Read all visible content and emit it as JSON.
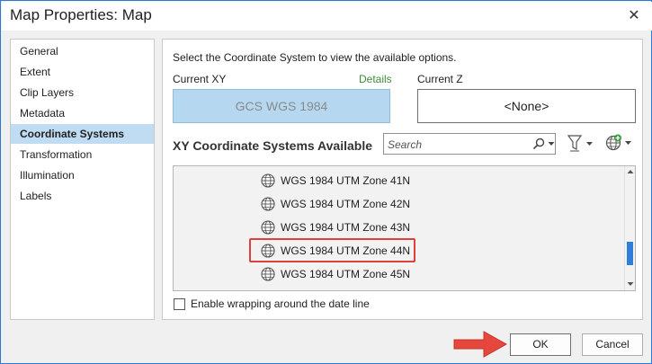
{
  "window": {
    "title": "Map Properties: Map",
    "close_symbol": "✕"
  },
  "sidebar": {
    "items": [
      {
        "label": "General",
        "active": false
      },
      {
        "label": "Extent",
        "active": false
      },
      {
        "label": "Clip Layers",
        "active": false
      },
      {
        "label": "Metadata",
        "active": false
      },
      {
        "label": "Coordinate Systems",
        "active": true
      },
      {
        "label": "Transformation",
        "active": false
      },
      {
        "label": "Illumination",
        "active": false
      },
      {
        "label": "Labels",
        "active": false
      }
    ]
  },
  "main": {
    "instruction": "Select the Coordinate System to view the available options.",
    "current_xy": {
      "label": "Current XY",
      "details_link": "Details",
      "value": "GCS WGS 1984"
    },
    "current_z": {
      "label": "Current Z",
      "value": "<None>"
    },
    "available": {
      "label": "XY Coordinate Systems Available",
      "search_placeholder": "Search",
      "items": [
        {
          "label": "WGS 1984 UTM Zone 41N",
          "icon": "globe-icon",
          "highlighted": false
        },
        {
          "label": "WGS 1984 UTM Zone 42N",
          "icon": "globe-icon",
          "highlighted": false
        },
        {
          "label": "WGS 1984 UTM Zone 43N",
          "icon": "globe-icon",
          "highlighted": false
        },
        {
          "label": "WGS 1984 UTM Zone 44N",
          "icon": "globe-icon",
          "highlighted": true
        },
        {
          "label": "WGS 1984 UTM Zone 45N",
          "icon": "globe-icon",
          "highlighted": false
        }
      ],
      "scroll_position": 0.65
    },
    "wrap_option": {
      "label": "Enable wrapping around the date line",
      "checked": false
    }
  },
  "footer": {
    "ok_label": "OK",
    "cancel_label": "Cancel"
  },
  "colors": {
    "window_border": "#2b7bd6",
    "active_tab_bg": "#bfdcf3",
    "current_xy_bg": "#b5d7f0",
    "details_link": "#3f8a3a",
    "highlight_border": "#e0403a",
    "arrow": "#e5473c",
    "scroll_thumb": "#2f7ed8"
  }
}
